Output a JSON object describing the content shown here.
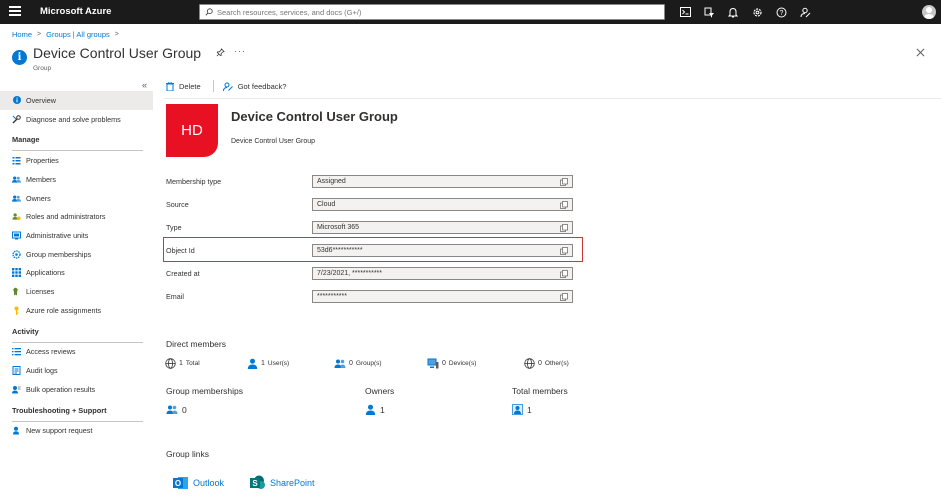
{
  "app": {
    "brand": "Microsoft Azure",
    "search_placeholder": "Search resources, services, and docs (G+/)"
  },
  "breadcrumb": [
    "Home",
    "Groups | All groups"
  ],
  "page": {
    "title": "Device Control User Group",
    "subtitle": "Group"
  },
  "toolbar": {
    "delete_label": "Delete",
    "feedback_label": "Got feedback?"
  },
  "sidebar": {
    "items_top": [
      {
        "label": "Overview",
        "icon": "info-icon",
        "active": true
      },
      {
        "label": "Diagnose and solve problems",
        "icon": "wrench-icon",
        "active": false
      }
    ],
    "sections": [
      {
        "title": "Manage",
        "items": [
          {
            "label": "Properties",
            "icon": "properties-icon"
          },
          {
            "label": "Members",
            "icon": "members-icon"
          },
          {
            "label": "Owners",
            "icon": "owners-icon"
          },
          {
            "label": "Roles and administrators",
            "icon": "roles-icon"
          },
          {
            "label": "Administrative units",
            "icon": "admin-units-icon"
          },
          {
            "label": "Group memberships",
            "icon": "gear-icon"
          },
          {
            "label": "Applications",
            "icon": "apps-grid-icon"
          },
          {
            "label": "Licenses",
            "icon": "license-icon"
          },
          {
            "label": "Azure role assignments",
            "icon": "key-icon"
          }
        ]
      },
      {
        "title": "Activity",
        "items": [
          {
            "label": "Access reviews",
            "icon": "list-icon"
          },
          {
            "label": "Audit logs",
            "icon": "log-icon"
          },
          {
            "label": "Bulk operation results",
            "icon": "bulk-icon"
          }
        ]
      },
      {
        "title": "Troubleshooting + Support",
        "items": [
          {
            "label": "New support request",
            "icon": "support-icon"
          }
        ]
      }
    ]
  },
  "group": {
    "initials": "HD",
    "name": "Device Control User Group",
    "description": "Device Control User Group",
    "accent_color": "#e81123"
  },
  "properties": [
    {
      "label": "Membership type",
      "value": "Assigned"
    },
    {
      "label": "Source",
      "value": "Cloud"
    },
    {
      "label": "Type",
      "value": "Microsoft 365"
    },
    {
      "label": "Object Id",
      "value": "53d6***********"
    },
    {
      "label": "Created at",
      "value": "7/23/2021, ***********"
    },
    {
      "label": "Email",
      "value": "***********"
    }
  ],
  "direct_members": {
    "title": "Direct members",
    "stats": [
      {
        "count": "1",
        "label": "Total"
      },
      {
        "count": "1",
        "label": "User(s)"
      },
      {
        "count": "0",
        "label": "Group(s)"
      },
      {
        "count": "0",
        "label": "Device(s)"
      },
      {
        "count": "0",
        "label": "Other(s)"
      }
    ]
  },
  "summary": [
    {
      "title": "Group memberships",
      "value": "0"
    },
    {
      "title": "Owners",
      "value": "1"
    },
    {
      "title": "Total members",
      "value": "1"
    }
  ],
  "group_links": {
    "title": "Group links",
    "links": [
      {
        "label": "Outlook",
        "color": "#0078d4"
      },
      {
        "label": "SharePoint",
        "color": "#038387"
      }
    ]
  }
}
